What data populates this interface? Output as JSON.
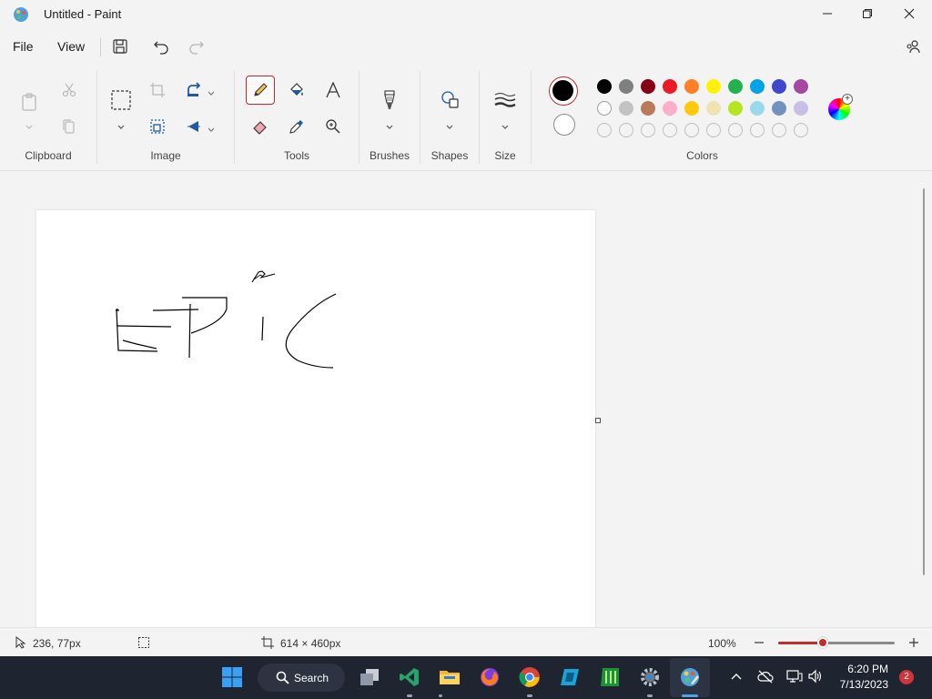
{
  "window": {
    "title": "Untitled - Paint"
  },
  "menu": {
    "file": "File",
    "view": "View"
  },
  "ribbon": {
    "groups": {
      "clipboard": "Clipboard",
      "image": "Image",
      "tools": "Tools",
      "brushes": "Brushes",
      "shapes": "Shapes",
      "size": "Size",
      "colors": "Colors"
    },
    "active_tool": "pencil"
  },
  "colors": {
    "primary": "#000000",
    "secondary": "#ffffff",
    "row1": [
      "#000000",
      "#7f7f7f",
      "#880015",
      "#ed1c24",
      "#ff7f27",
      "#fff200",
      "#22b14c",
      "#00a2e8",
      "#3f48cc",
      "#a349a4"
    ],
    "row2": [
      "#ffffff",
      "#c3c3c3",
      "#b97a57",
      "#ffaec9",
      "#ffc90e",
      "#efe4b0",
      "#b5e61d",
      "#99d9ea",
      "#7092be",
      "#c8bfe7"
    ],
    "row3_empty_count": 10
  },
  "status": {
    "cursor_pos": "236, 77px",
    "canvas_size": "614 × 460px",
    "zoom": "100%",
    "zoom_fraction": 0.38
  },
  "taskbar": {
    "search_label": "Search",
    "time": "6:20 PM",
    "date": "7/13/2023",
    "notification_count": "2"
  }
}
